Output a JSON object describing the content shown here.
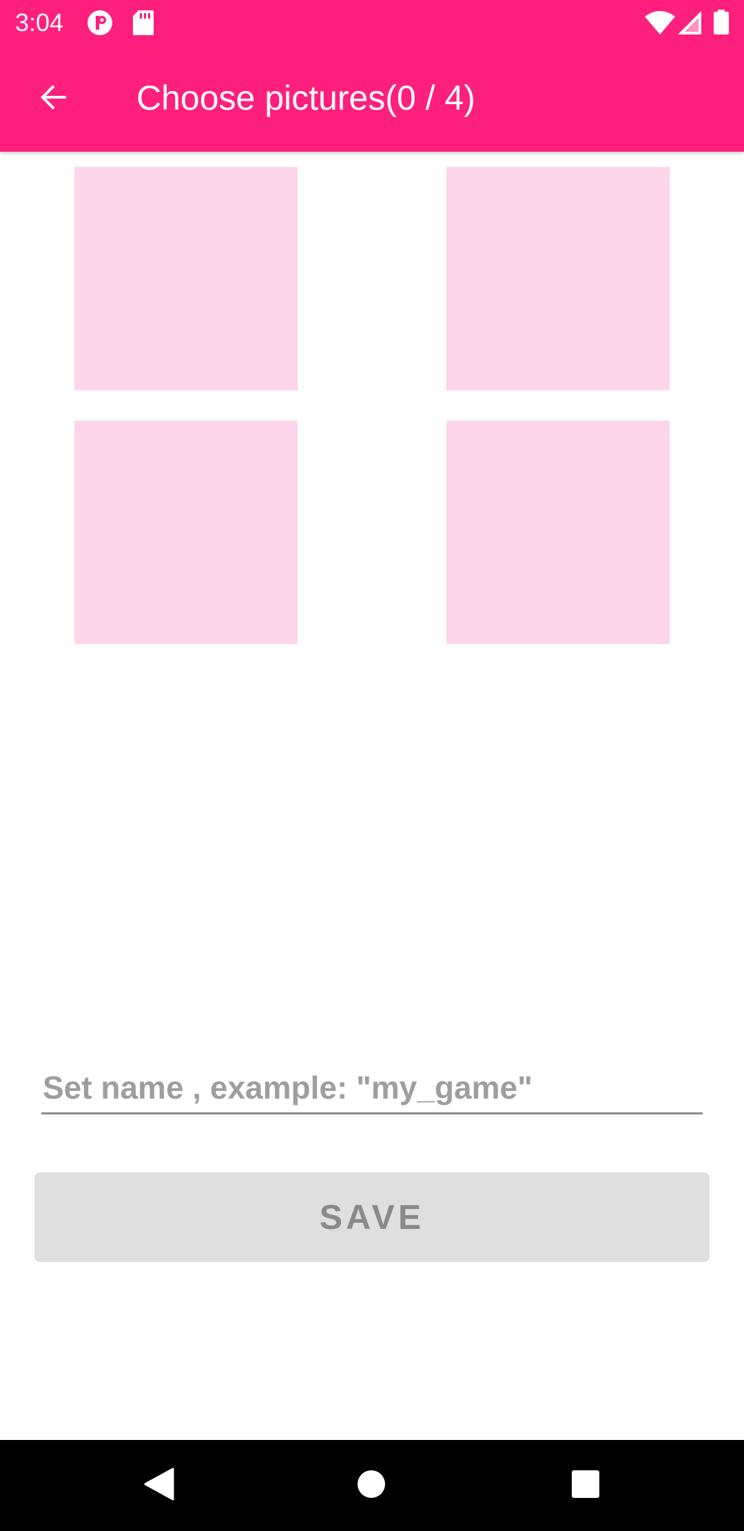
{
  "status_bar": {
    "time": "3:04",
    "icons": [
      "notification-app-icon",
      "sd-card-icon",
      "wifi-icon",
      "cell-signal-icon",
      "battery-icon"
    ]
  },
  "app_bar": {
    "title": "Choose pictures(0 / 4)",
    "back_icon": "arrow-back-icon",
    "background_color": "#FF1F7C"
  },
  "picture_grid": {
    "slot_color": "#FCD5EA",
    "slots": [
      "picture-slot-1",
      "picture-slot-2",
      "picture-slot-3",
      "picture-slot-4"
    ]
  },
  "name_input": {
    "value": "",
    "placeholder": "Set name , example: \"my_game\""
  },
  "save_button": {
    "label": "SAVE"
  },
  "nav_bar": {
    "icons": [
      "back-triangle-icon",
      "home-circle-icon",
      "recents-square-icon"
    ]
  }
}
